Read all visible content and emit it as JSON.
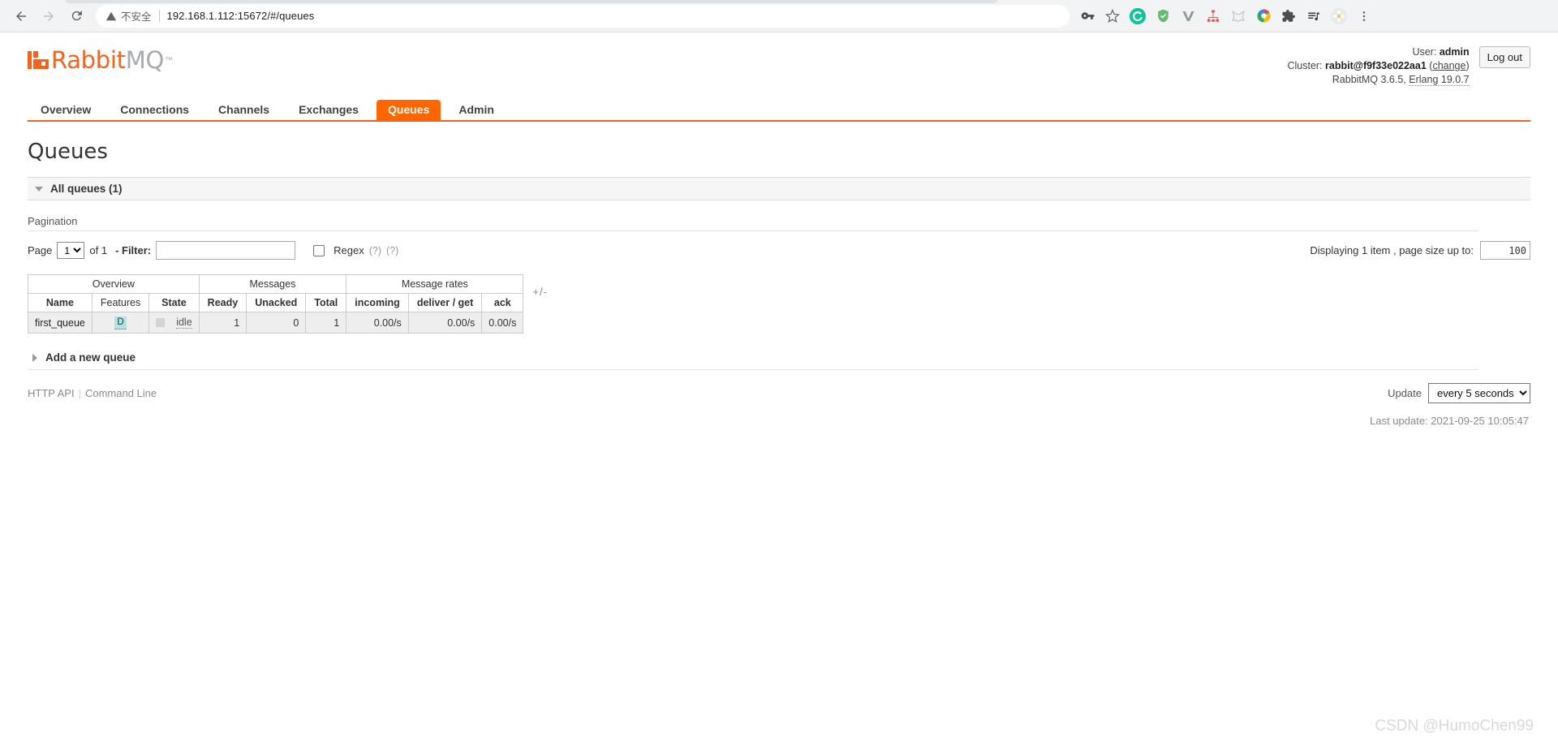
{
  "browser": {
    "security_label": "不安全",
    "url": "192.168.1.112:15672/#/queues",
    "back_icon": "back-arrow-icon",
    "forward_icon": "forward-arrow-icon",
    "reload_icon": "reload-icon",
    "warning_icon": "warning-triangle-icon",
    "extensions": [
      "key-icon",
      "bookmark-star-icon",
      "grammarly-icon",
      "adguard-shield-icon",
      "vimium-v-icon",
      "sitemap-icon",
      "metamask-fox-icon",
      "colorzilla-icon",
      "puzzle-extensions-icon",
      "playlist-icon",
      "daisy-profile-icon",
      "chrome-menu-icon"
    ]
  },
  "header": {
    "logo_primary": "Rabbit",
    "logo_secondary": "MQ",
    "logo_tm": "™",
    "user_label": "User:",
    "user_name": "admin",
    "cluster_label": "Cluster:",
    "cluster_name": "rabbit@f9f33e022aa1",
    "cluster_change": "change",
    "version": "RabbitMQ 3.6.5,",
    "erlang": "Erlang 19.0.7",
    "logout_label": "Log out"
  },
  "nav": {
    "tabs": [
      {
        "label": "Overview",
        "active": false
      },
      {
        "label": "Connections",
        "active": false
      },
      {
        "label": "Channels",
        "active": false
      },
      {
        "label": "Exchanges",
        "active": false
      },
      {
        "label": "Queues",
        "active": true
      },
      {
        "label": "Admin",
        "active": false
      }
    ]
  },
  "main": {
    "title": "Queues",
    "section_all_queues": "All queues (1)",
    "pagination_title": "Pagination",
    "page_label": "Page",
    "page_value": "1",
    "page_of": "of 1",
    "filter_label": "- Filter:",
    "filter_value": "",
    "filter_placeholder": "",
    "regex_label": "Regex",
    "help_1": "(?)",
    "help_2": "(?)",
    "displaying_text": "Displaying 1 item , page size up to:",
    "page_size": "100",
    "plus_minus": "+/-",
    "add_new_queue": "Add a new queue"
  },
  "table": {
    "group_headers": [
      {
        "label": "Overview",
        "span": 3
      },
      {
        "label": "Messages",
        "span": 3
      },
      {
        "label": "Message rates",
        "span": 3
      }
    ],
    "columns": [
      "Name",
      "Features",
      "State",
      "Ready",
      "Unacked",
      "Total",
      "incoming",
      "deliver / get",
      "ack"
    ],
    "rows": [
      {
        "name": "first_queue",
        "features": "D",
        "state": "idle",
        "ready": "1",
        "unacked": "0",
        "total": "1",
        "incoming": "0.00/s",
        "deliver_get": "0.00/s",
        "ack": "0.00/s"
      }
    ]
  },
  "footer": {
    "http_api": "HTTP API",
    "command_line": "Command Line",
    "update_label": "Update",
    "update_value": "every 5 seconds",
    "last_update": "Last update: 2021-09-25 10:05:47"
  },
  "watermark": "CSDN @HumoChen99",
  "colors": {
    "brand_orange": "#f26322",
    "active_tab": "#ff6600",
    "feature_badge": "#b1e4e4"
  }
}
